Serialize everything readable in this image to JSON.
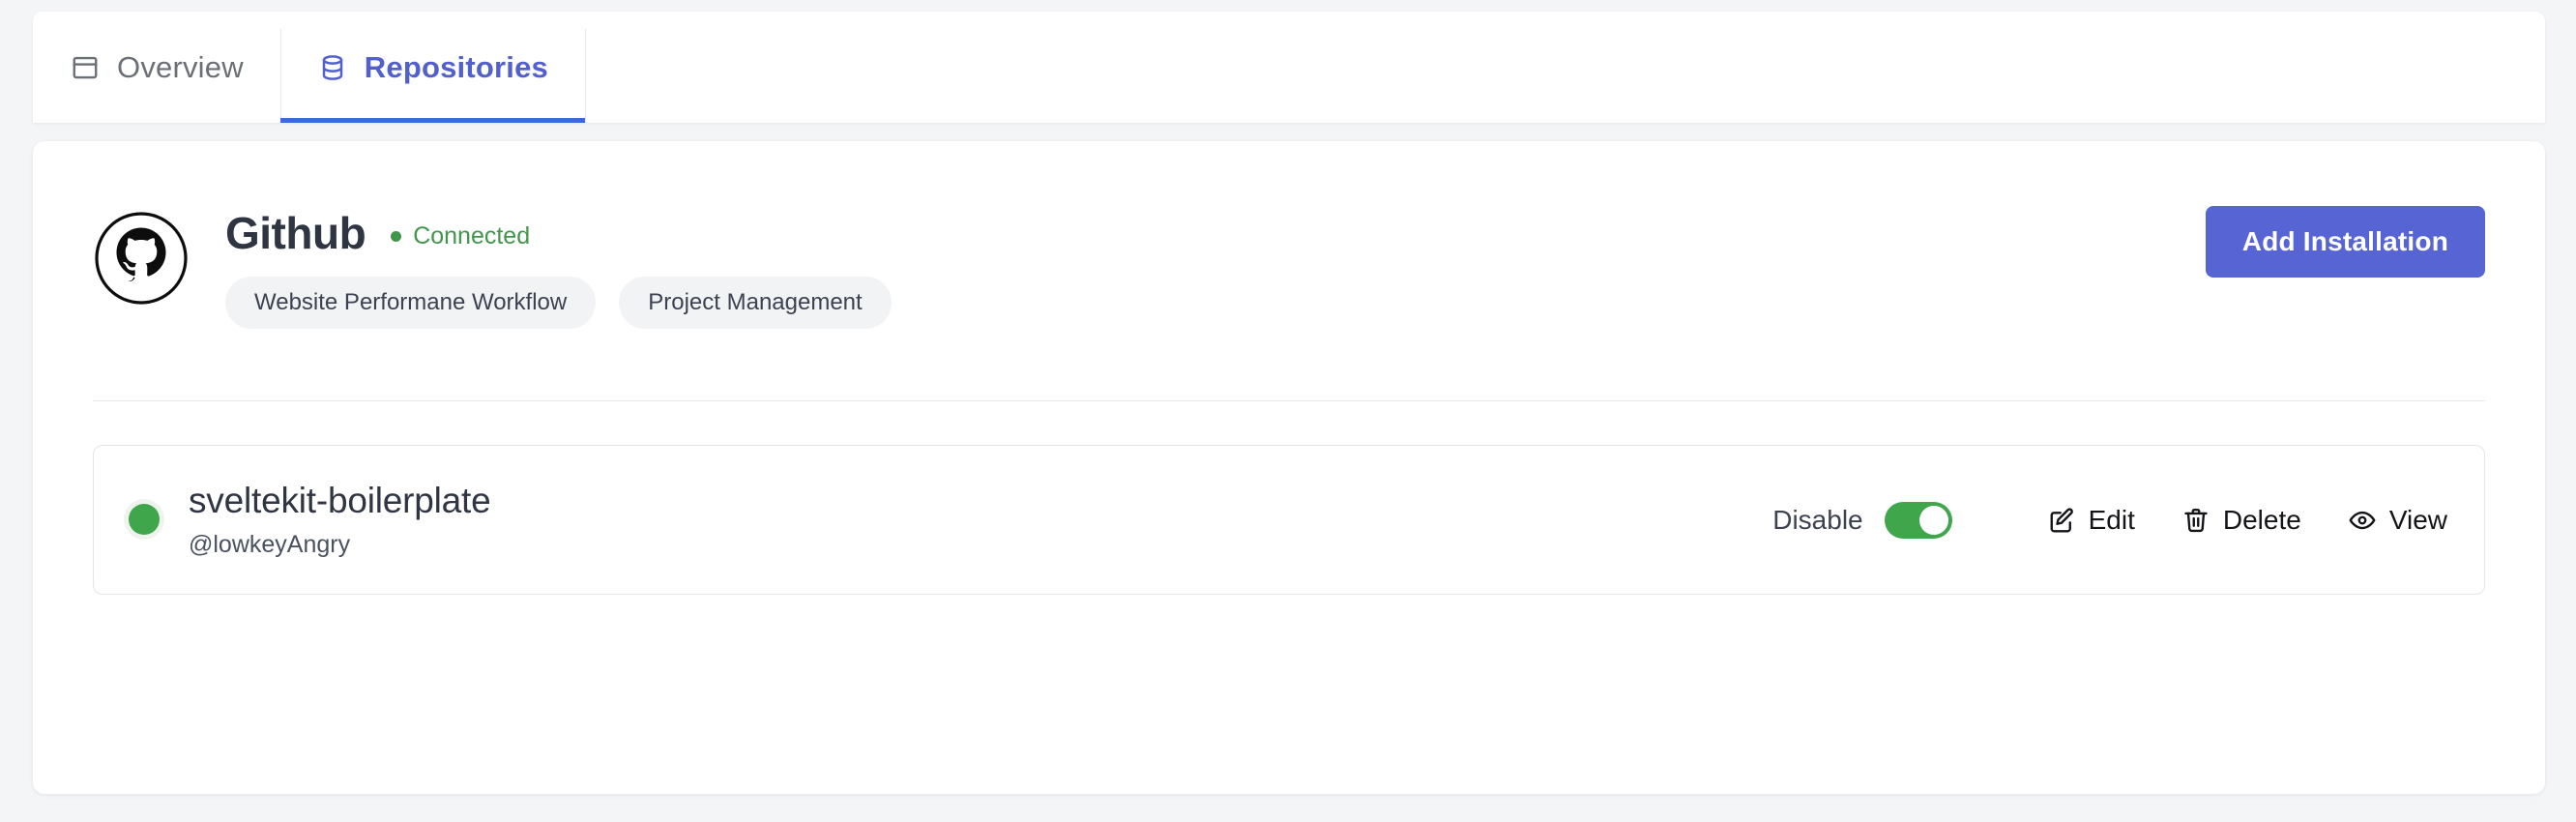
{
  "colors": {
    "page_background": "#f4f5f7",
    "surface": "#ffffff",
    "active_tab_text": "#5260cf",
    "active_tab_underline": "#3b6ae0",
    "inactive_tab_text": "#6b6f76",
    "primary_button": "#5765d4",
    "status_connected": "#41964b",
    "toggle_on": "#3fa64b",
    "repo_status_dot": "#3fa64b",
    "divider": "#e8eaed"
  },
  "tabs": [
    {
      "id": "overview",
      "label": "Overview",
      "icon": "layout-panel-icon",
      "active": false
    },
    {
      "id": "repositories",
      "label": "Repositories",
      "icon": "database-icon",
      "active": true
    }
  ],
  "provider": {
    "logo_icon": "github-logo-icon",
    "name": "Github",
    "status": {
      "text": "Connected",
      "dot_icon": "status-dot-icon"
    },
    "tags": [
      "Website Performane Workflow",
      "Project Management"
    ],
    "primary_action": "Add Installation"
  },
  "repositories": [
    {
      "status_icon": "green-status-dot-icon",
      "name": "sveltekit-boilerplate",
      "owner": "@lowkeyAngry",
      "toggle": {
        "label": "Disable",
        "state": "on"
      },
      "actions": [
        {
          "id": "edit",
          "label": "Edit",
          "icon": "edit-pencil-icon"
        },
        {
          "id": "delete",
          "label": "Delete",
          "icon": "trash-icon"
        },
        {
          "id": "view",
          "label": "View",
          "icon": "eye-icon"
        }
      ]
    }
  ]
}
